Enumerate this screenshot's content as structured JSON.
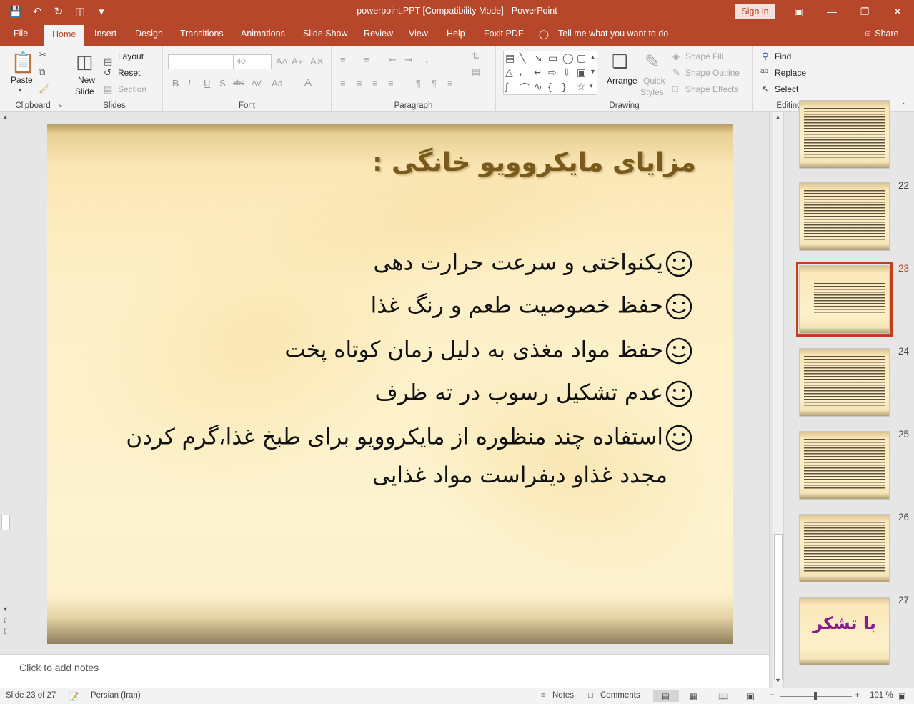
{
  "window": {
    "title": "powerpoint.PPT [Compatibility Mode]  -  PowerPoint",
    "signin": "Sign in"
  },
  "tabs": [
    "File",
    "Home",
    "Insert",
    "Design",
    "Transitions",
    "Animations",
    "Slide Show",
    "Review",
    "View",
    "Help",
    "Foxit PDF"
  ],
  "active_tab": "Home",
  "tell_me": "Tell me what you want to do",
  "share": "Share",
  "ribbon": {
    "clipboard": {
      "paste": "Paste",
      "label": "Clipboard"
    },
    "slides": {
      "new_slide": "New",
      "new_slide2": "Slide",
      "layout": "Layout",
      "reset": "Reset",
      "section": "Section",
      "label": "Slides"
    },
    "font": {
      "size": "40",
      "label": "Font"
    },
    "paragraph": {
      "label": "Paragraph"
    },
    "drawing": {
      "arrange": "Arrange",
      "quick_styles": "Quick",
      "quick_styles2": "Styles",
      "shape_fill": "Shape Fill",
      "shape_outline": "Shape Outline",
      "shape_effects": "Shape Effects",
      "label": "Drawing"
    },
    "editing": {
      "find": "Find",
      "replace": "Replace",
      "select": "Select",
      "label": "Editing"
    }
  },
  "slide": {
    "title": "مزایای مایکروویو خانگی :",
    "bullets": [
      "یکنواختی و سرعت حرارت دهی",
      "حفظ خصوصیت طعم و رنگ غذا",
      "حفظ مواد مغذی به دلیل زمان کوتاه پخت",
      "عدم تشکیل رسوب در ته ظرف",
      "استفاده چند منظوره از مایکروویو برای طبخ غذا،گرم کردن"
    ],
    "bullet_continuation": "مجدد غذاو دیفراست مواد غذایی"
  },
  "notes_placeholder": "Click to add notes",
  "thumbnails": [
    {
      "num": "",
      "thanks": ""
    },
    {
      "num": "22",
      "thanks": ""
    },
    {
      "num": "23",
      "thanks": "",
      "selected": true
    },
    {
      "num": "24",
      "thanks": ""
    },
    {
      "num": "25",
      "thanks": ""
    },
    {
      "num": "26",
      "thanks": ""
    },
    {
      "num": "27",
      "thanks": "با تشکر"
    }
  ],
  "status": {
    "slide_info": "Slide 23 of 27",
    "language": "Persian (Iran)",
    "notes": "Notes",
    "comments": "Comments",
    "zoom": "101 %"
  }
}
